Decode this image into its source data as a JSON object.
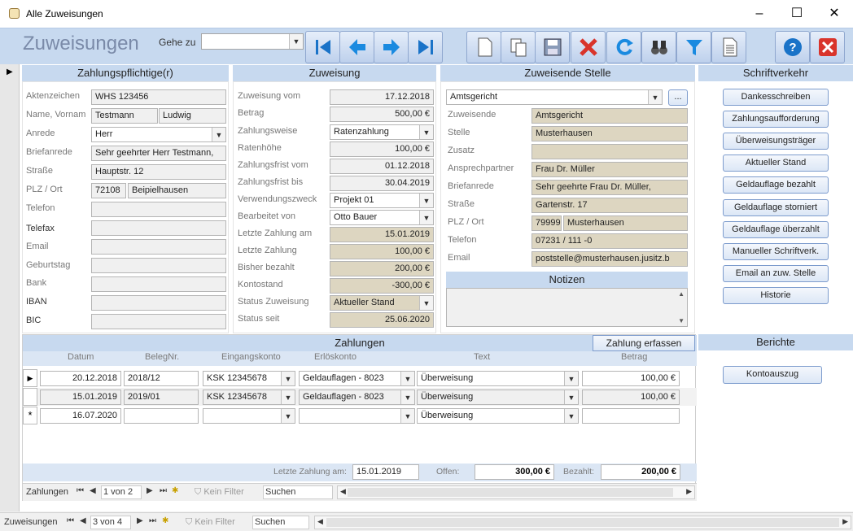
{
  "window": {
    "title": "Alle Zuweisungen"
  },
  "toolbar": {
    "app_title": "Zuweisungen",
    "gehe_zu_label": "Gehe zu",
    "gehe_zu_value": ""
  },
  "zahlungspflichtige": {
    "title": "Zahlungspflichtige(r)",
    "aktenzeichen_label": "Aktenzeichen",
    "aktenzeichen": "WHS 123456",
    "name_label": "Name, Vornam",
    "name": "Testmann",
    "vorname": "Ludwig",
    "anrede_label": "Anrede",
    "anrede": "Herr",
    "briefanrede_label": "Briefanrede",
    "briefanrede": "Sehr geehrter Herr Testmann,",
    "strasse_label": "Straße",
    "strasse": "Hauptstr. 12",
    "plz_ort_label": "PLZ / Ort",
    "plz": "72108",
    "ort": "Beipielhausen",
    "telefon_label": "Telefon",
    "telefon": "",
    "telefax_label": "Telefax",
    "telefax": "",
    "email_label": "Email",
    "email": "",
    "geburtstag_label": "Geburtstag",
    "geburtstag": "",
    "bank_label": "Bank",
    "bank": "",
    "iban_label": "IBAN",
    "iban": "",
    "bic_label": "BIC",
    "bic": ""
  },
  "zuweisung": {
    "title": "Zuweisung",
    "vom_label": "Zuweisung vom",
    "vom": "17.12.2018",
    "betrag_label": "Betrag",
    "betrag": "500,00 €",
    "zahlungsweise_label": "Zahlungsweise",
    "zahlungsweise": "Ratenzahlung",
    "ratenhoehe_label": "Ratenhöhe",
    "ratenhoehe": "100,00 €",
    "frist_vom_label": "Zahlungsfrist vom",
    "frist_vom": "01.12.2018",
    "frist_bis_label": "Zahlungsfrist bis",
    "frist_bis": "30.04.2019",
    "verwendungszweck_label": "Verwendungszweck",
    "verwendungszweck": "Projekt 01",
    "bearbeitet_label": "Bearbeitet von",
    "bearbeitet": "Otto Bauer",
    "letzte_am_label": "Letzte Zahlung am",
    "letzte_am": "15.01.2019",
    "letzte_label": "Letzte Zahlung",
    "letzte": "100,00 €",
    "bisher_label": "Bisher bezahlt",
    "bisher": "200,00 €",
    "kontostand_label": "Kontostand",
    "kontostand": "-300,00 €",
    "status_label": "Status Zuweisung",
    "status": "Aktueller Stand",
    "status_seit_label": "Status seit",
    "status_seit": "25.06.2020"
  },
  "stelle": {
    "title": "Zuweisende Stelle",
    "combo": "Amtsgericht",
    "more_label": "...",
    "zuweisende_label": "Zuweisende",
    "zuweisende": "Amtsgericht",
    "stelle_label": "Stelle",
    "stelle": "Musterhausen",
    "zusatz_label": "Zusatz",
    "zusatz": "",
    "ansprechpartner_label": "Ansprechpartner",
    "ansprechpartner": "Frau Dr. Müller",
    "briefanrede_label": "Briefanrede",
    "briefanrede": "Sehr geehrte Frau Dr. Müller,",
    "strasse_label": "Straße",
    "strasse": "Gartenstr. 17",
    "plz_ort_label": "PLZ / Ort",
    "plz": "79999",
    "ort": "Musterhausen",
    "telefon_label": "Telefon",
    "telefon": "07231 / 111 -0",
    "email_label": "Email",
    "email": "poststelle@musterhausen.jusitz.b",
    "notizen_title": "Notizen"
  },
  "schriftverkehr": {
    "title": "Schriftverkehr",
    "buttons": [
      "Dankesschreiben",
      "Zahlungsaufforderung",
      "Überweisungsträger",
      "Aktueller Stand",
      "Geldauflage bezahlt",
      "Geldauflage storniert",
      "Geldauflage überzahlt",
      "Manueller Schriftverk.",
      "Email an zuw. Stelle",
      "Historie"
    ]
  },
  "zahlungen": {
    "title": "Zahlungen",
    "erfassen_label": "Zahlung erfassen",
    "columns": [
      "Datum",
      "BelegNr.",
      "Eingangskonto",
      "Erlöskonto",
      "Text",
      "Betrag"
    ],
    "rows": [
      {
        "datum": "20.12.2018",
        "beleg": "2018/12",
        "eingang": "KSK 12345678",
        "erloes": "Geldauflagen - 8023",
        "text": "Überweisung",
        "betrag": "100,00 €"
      },
      {
        "datum": "15.01.2019",
        "beleg": "2019/01",
        "eingang": "KSK 12345678",
        "erloes": "Geldauflagen - 8023",
        "text": "Überweisung",
        "betrag": "100,00 €"
      },
      {
        "datum": "16.07.2020",
        "beleg": "",
        "eingang": "",
        "erloes": "",
        "text": "Überweisung",
        "betrag": ""
      }
    ],
    "footer": {
      "letzte_label": "Letzte Zahlung am:",
      "letzte": "15.01.2019",
      "offen_label": "Offen:",
      "offen": "300,00 €",
      "bezahlt_label": "Bezahlt:",
      "bezahlt": "200,00 €"
    },
    "nav": {
      "label": "Zahlungen",
      "record": "1 von 2",
      "filter": "Kein Filter",
      "search": "Suchen"
    }
  },
  "berichte": {
    "title": "Berichte",
    "button": "Kontoauszug"
  },
  "mainnav": {
    "label": "Zuweisungen",
    "record": "3 von 4",
    "filter": "Kein Filter",
    "search": "Suchen"
  },
  "colors": {
    "header": "#c7d9ef",
    "tan": "#ddd6c1",
    "accent": "#1a73c8",
    "close_red": "#d9342b"
  }
}
